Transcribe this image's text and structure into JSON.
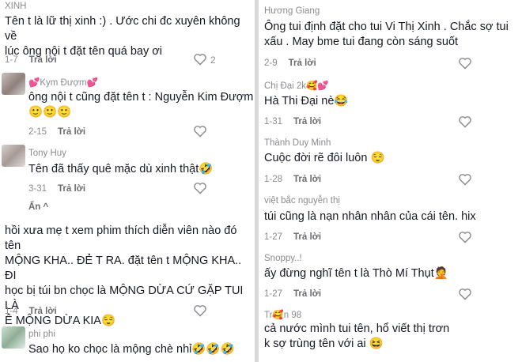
{
  "reply_label": "Trả lời",
  "left": {
    "comments": [
      {
        "username": "XINH",
        "text": "Tên t là lữ thị xinh :) . Ước chi đc xuyên không về\nlúc ông nội t đặt tên quá bay ơi",
        "date": "1-7",
        "likes": "2"
      },
      {
        "username": "💕Kym Đượm💕",
        "text": "ông nội t cũng đặt tên t : Nguyễn Kim Đượm\n🙂🙂🙂",
        "date": "2-15",
        "likes": ""
      },
      {
        "username": "Tony Huy",
        "text": "Tên đã thấy quê mặc dù xinh thật🤣",
        "date": "3-31",
        "likes": ""
      },
      {
        "username": "",
        "text": "hồi xưa mẹ t xem phim thích diễn viên nào đó tên\nMỘNG KHA.. ĐẺ T RA. đặt tên t MỘNG KHA.. ĐI\nhọc bị túi bn chọc là MỘNG DỪA CỨ GẶP TUI LÀ\nÊ MỘNG DỪA KIA😌",
        "date": "1-4",
        "likes": ""
      },
      {
        "username": "phi phi",
        "text": "Sao họ ko chọc là mộng chè nhỉ🤣🤣🤣",
        "date": "",
        "likes": ""
      }
    ],
    "hide_label": "Ẩn ^"
  },
  "right": {
    "comments": [
      {
        "username": "Hương Giang",
        "text": "Ông tui định đặt cho tui Vi Thị Xinh . Chắc sợ tui\nxấu . May bme tui đang còn sáng suốt",
        "date": "2-9"
      },
      {
        "username": "Chị Đại 2k🥰💕",
        "text": "Hà Thi Đại nè😂",
        "date": "1-31"
      },
      {
        "username": "Thành Duy Minh",
        "text": "Cuộc đời rẽ đôi luôn 😌",
        "date": "1-28"
      },
      {
        "username": "việt bắc nguyễn thị",
        "text": "túi cũng là nạn nhân nhân của cái tên. hix",
        "date": "1-27"
      },
      {
        "username": "Snoppy..!",
        "text": "ấy đừng nghĩ tên t là Thò Mí Thụt🤦",
        "date": "1-27"
      },
      {
        "username": "Tr🥰n 98",
        "text": "cả nước mình tui tên, hổ viết thị trơn\nk sợ trùng tên với ai 😆",
        "date": ""
      }
    ]
  }
}
